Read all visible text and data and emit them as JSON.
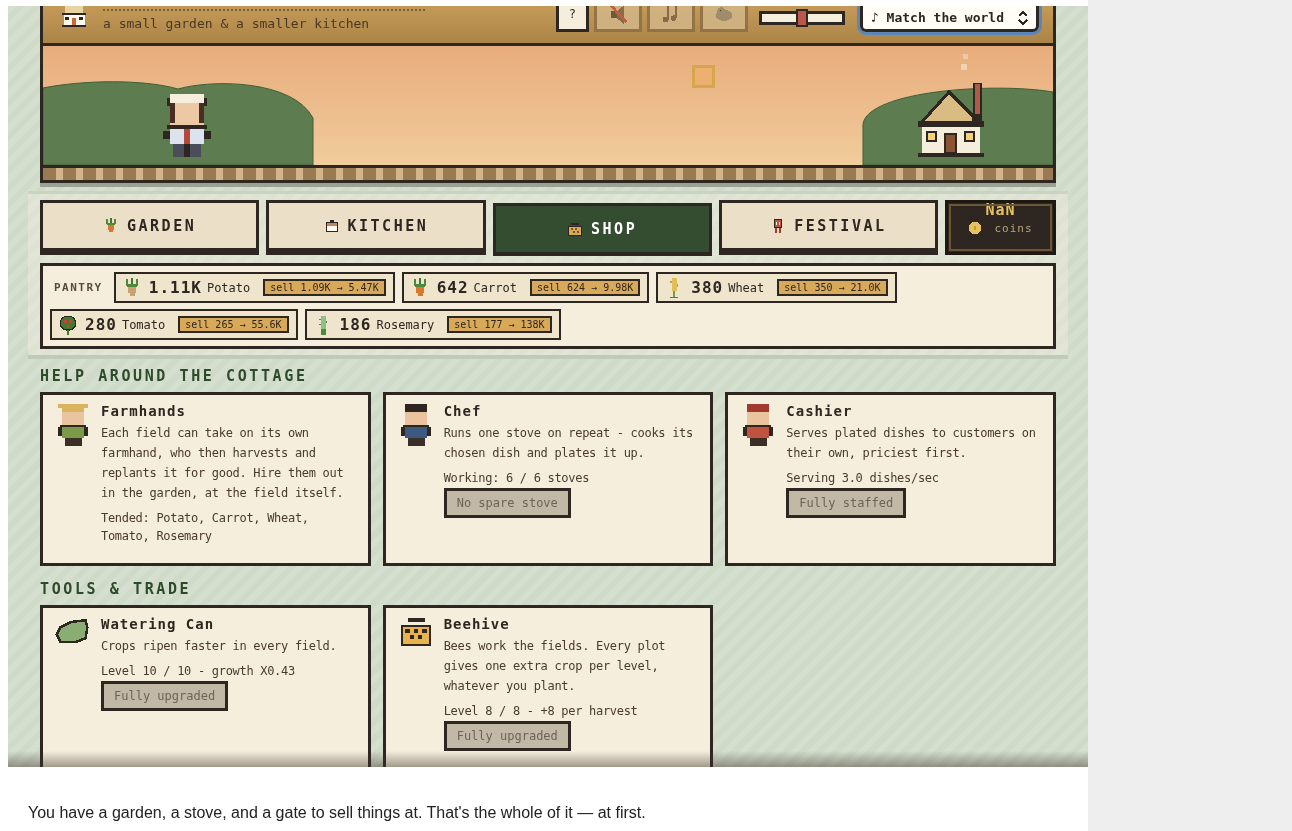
{
  "header": {
    "subtitle": "a small garden & a smaller kitchen",
    "help_button": "?",
    "icon_buttons": [
      {
        "kind": "sound"
      },
      {
        "kind": "music"
      },
      {
        "kind": "bird"
      }
    ],
    "volume": {
      "level": 0.5
    },
    "music_select": "♪ Match the world"
  },
  "tabs": [
    {
      "label": "GARDEN",
      "selected": false
    },
    {
      "label": "KITCHEN",
      "selected": false
    },
    {
      "label": "SHOP",
      "selected": true
    },
    {
      "label": "FESTIVAL",
      "selected": false
    }
  ],
  "coins": {
    "value": "NaN",
    "label": "coins"
  },
  "pantry": {
    "label": "PANTRY",
    "items": [
      {
        "count": "1.11K",
        "name": "Potato",
        "sell": "sell 1.09K → 5.47K"
      },
      {
        "count": "642",
        "name": "Carrot",
        "sell": "sell 624 → 9.98K"
      },
      {
        "count": "380",
        "name": "Wheat",
        "sell": "sell 350 → 21.0K"
      },
      {
        "count": "280",
        "name": "Tomato",
        "sell": "sell 265 → 55.6K"
      },
      {
        "count": "186",
        "name": "Rosemary",
        "sell": "sell 177 → 138K"
      }
    ]
  },
  "sections": [
    {
      "title": "HELP AROUND THE COTTAGE",
      "cards": [
        {
          "name": "Farmhands",
          "description": "Each field can take on its own farmhand, who then harvests and replants it for good. Hire them out in the garden, at the field itself.",
          "status": "Tended: Potato, Carrot, Wheat, Tomato, Rosemary"
        },
        {
          "name": "Chef",
          "description": "Runs one stove on repeat - cooks its chosen dish and plates it up.",
          "status": "Working: 6 / 6 stoves",
          "button": {
            "label": "No spare stove",
            "disabled": true
          }
        },
        {
          "name": "Cashier",
          "description": "Serves plated dishes to customers on their own, priciest first.",
          "status": "Serving 3.0 dishes/sec",
          "button": {
            "label": "Fully staffed",
            "disabled": true
          }
        }
      ]
    },
    {
      "title": "TOOLS & TRADE",
      "cards": [
        {
          "name": "Watering Can",
          "description": "Crops ripen faster in every field.",
          "status": "Level 10 / 10 - growth X0.43",
          "button": {
            "label": "Fully upgraded",
            "disabled": true
          }
        },
        {
          "name": "Beehive",
          "description": "Bees work the fields. Every plot gives one extra crop per level, whatever you plant.",
          "status": "Level 8 / 8 - +8 per harvest",
          "button": {
            "label": "Fully upgraded",
            "disabled": true
          }
        }
      ]
    }
  ],
  "intro_text": "You have a garden, a stove, and a gate to sell things at. That's the whole of it — at first."
}
